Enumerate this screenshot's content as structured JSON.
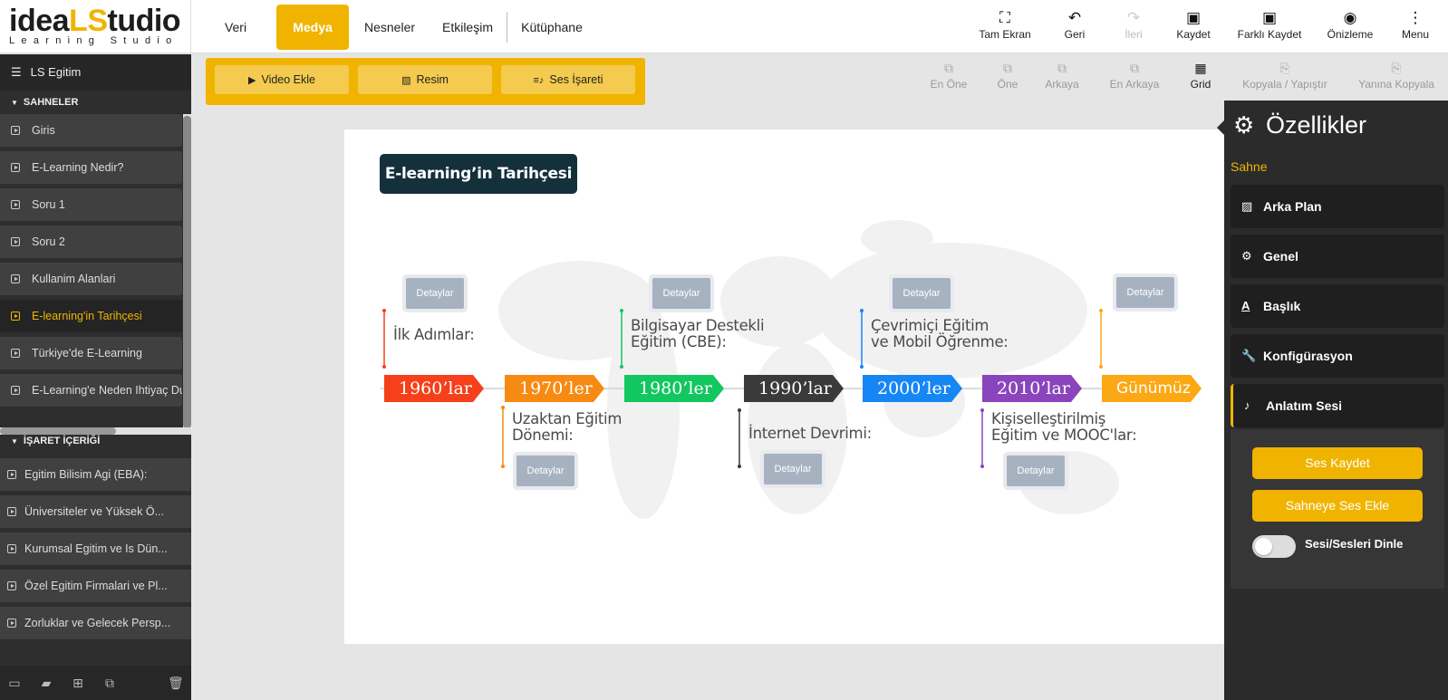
{
  "logo": {
    "main_a": "idea",
    "main_b": "LS",
    "main_c": "tudio",
    "sub": "Learning Studio"
  },
  "nav": {
    "tabs": [
      "Veri",
      "Medya",
      "Nesneler",
      "Etkileşim",
      "Kütüphane"
    ],
    "active": "Medya"
  },
  "toolbar": {
    "fullscreen": "Tam Ekran",
    "undo": "Geri",
    "redo": "İleri",
    "save": "Kaydet",
    "save_as": "Farklı Kaydet",
    "preview": "Önizleme",
    "menu": "Menu"
  },
  "project": {
    "name": "LS Egitim"
  },
  "scenes": {
    "header": "SAHNELER",
    "items": [
      "Giris",
      "E-Learning Nedir?",
      "Soru 1",
      "Soru 2",
      "Kullanim Alanlari",
      "E-learning'in Tarihçesi",
      "Türkiye'de E-Learning",
      "E-Learning'e Neden Ihtiyaç Duyulur"
    ],
    "selected": "E-learning'in Tarihçesi"
  },
  "markers": {
    "header": "İŞARET İÇERİĞİ",
    "items": [
      "Egitim Bilisim Agi (EBA):",
      "Üniversiteler ve Yüksek Ö...",
      "Kurumsal Egitim ve Is Dün...",
      "Özel Egitim Firmalari ve Pl...",
      "Zorluklar ve Gelecek Persp..."
    ]
  },
  "media_toolbar": {
    "video": "Video Ekle",
    "image": "Resim",
    "audio_marker": "Ses İşareti"
  },
  "arrange": {
    "front": "En Öne",
    "forward": "Öne",
    "backward": "Arkaya",
    "back": "En Arkaya",
    "grid": "Grid",
    "copy_paste": "Kopyala / Yapıştır",
    "duplicate": "Yanına Kopyala"
  },
  "slide": {
    "title": "E-learning’in Tarihçesi",
    "detail_label": "Detaylar",
    "timeline": [
      {
        "label": "1960’lar",
        "color": "#f5401b"
      },
      {
        "label": "1970’ler",
        "color": "#f78a13"
      },
      {
        "label": "1980’ler",
        "color": "#12c760"
      },
      {
        "label": "1990’lar",
        "color": "#3a3a3a"
      },
      {
        "label": "2000’ler",
        "color": "#1786f5"
      },
      {
        "label": "2010’lar",
        "color": "#8a45bd"
      },
      {
        "label": "Günümüz",
        "color": "#fca814"
      }
    ],
    "texts": {
      "ilk": "İlk Adımlar:",
      "cbe_1": "Bilgisayar Destekli",
      "cbe_2": "Eğitim (CBE):",
      "mobil_1": "Çevrimiçi Eğitim",
      "mobil_2": "ve Mobil Öğrenme:",
      "uzaktan_1": "Uzaktan Eğitim",
      "uzaktan_2": "Dönemi:",
      "internet": "İnternet Devrimi:",
      "mooc_1": "Kişiselleştirilmiş",
      "mooc_2": "Eğitim ve MOOC'lar:"
    }
  },
  "properties": {
    "title": "Özellikler",
    "section": "Sahne",
    "rows": [
      "Arka Plan",
      "Genel",
      "Başlık",
      "Konfigürasyon",
      "Anlatım Sesi"
    ],
    "active": "Anlatım Sesi",
    "record": "Ses Kaydet",
    "add_audio": "Sahneye Ses Ekle",
    "listen": "Sesi/Sesleri Dinle",
    "listen_on": false
  },
  "colors": {
    "accent": "#f0b400",
    "panel": "#2e2e2e",
    "title_bg": "#14303b"
  }
}
